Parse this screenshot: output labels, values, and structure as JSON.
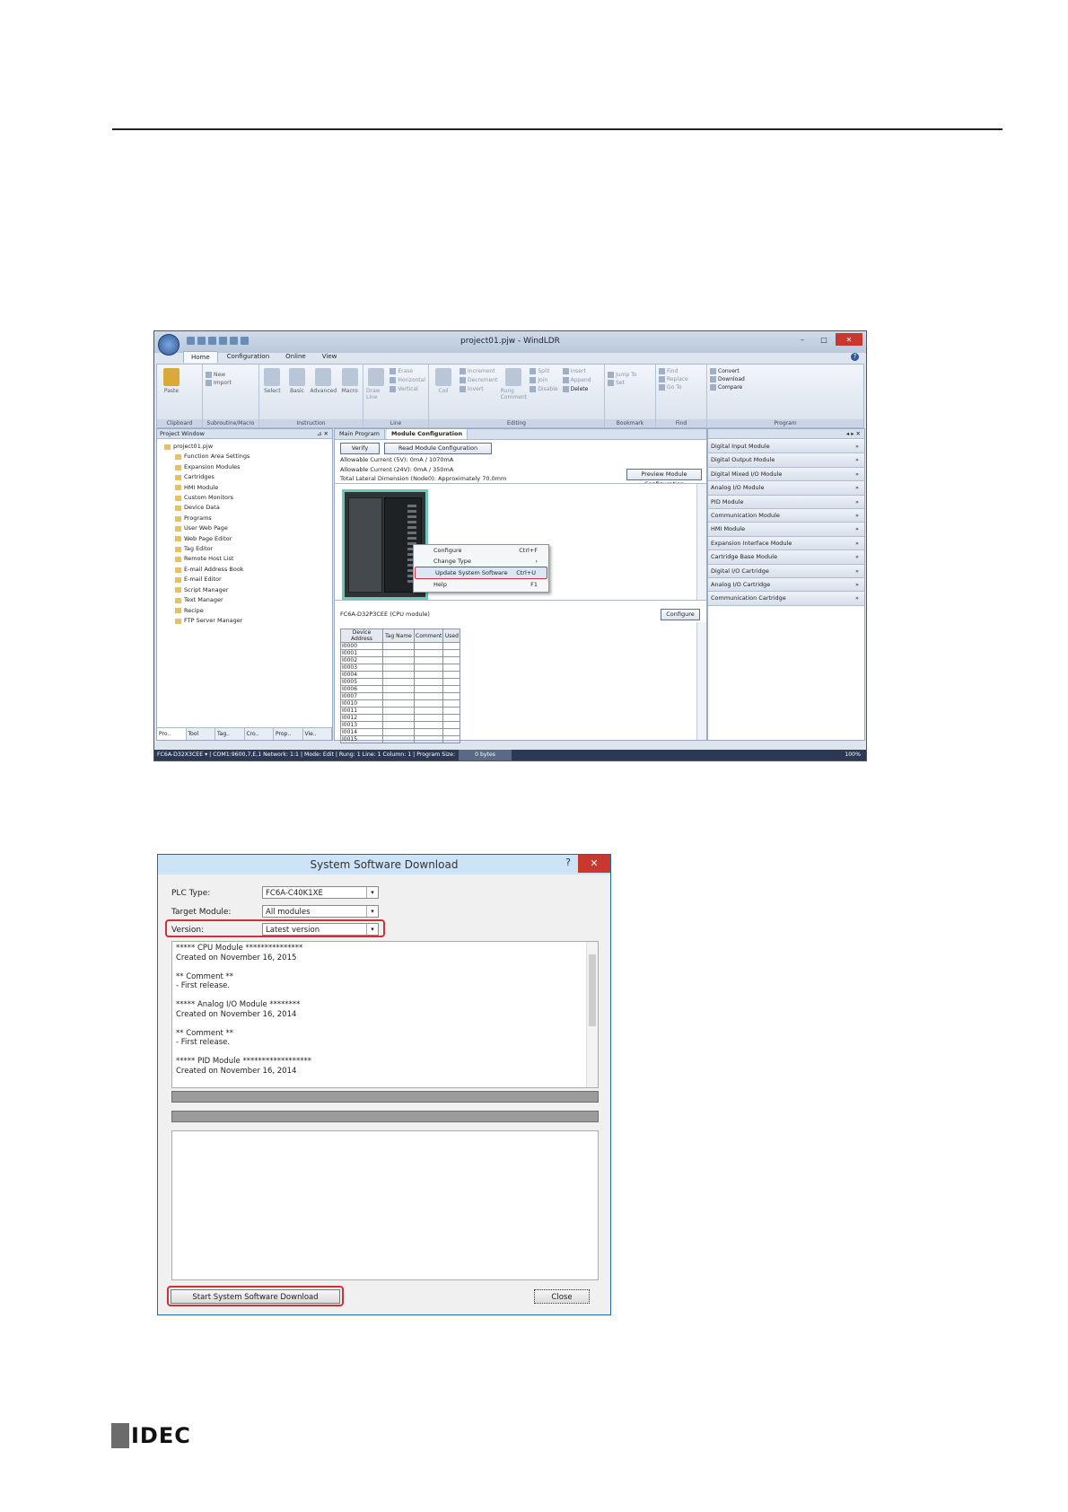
{
  "windldr": {
    "title": "project01.pjw - WindLDR",
    "window_controls": [
      "–",
      "□",
      "✕"
    ],
    "ribbon_tabs": [
      "Home",
      "Configuration",
      "Online",
      "View"
    ],
    "ribbon_groups": [
      {
        "name": "Clipboard",
        "items": [
          "Paste"
        ]
      },
      {
        "name": "Subroutine/Macro",
        "items": [
          "New",
          "Import"
        ]
      },
      {
        "name": "Instruction",
        "items": [
          "Select",
          "Basic",
          "Advanced",
          "Macro"
        ]
      },
      {
        "name": "Line",
        "items": [
          "Draw Line",
          "Erase",
          "Horizontal",
          "Vertical"
        ]
      },
      {
        "name": "Editing",
        "items": [
          "Coil",
          "Increment",
          "Decrement",
          "Invert",
          "Rung Comment",
          "Split",
          "Join",
          "Disable",
          "Insert",
          "Append",
          "Delete"
        ]
      },
      {
        "name": "Bookmark",
        "items": [
          "Jump To",
          "Set"
        ]
      },
      {
        "name": "Find",
        "items": [
          "Find",
          "Replace",
          "Go To"
        ]
      },
      {
        "name": "Program",
        "items": [
          "Convert",
          "Download",
          "Compare"
        ]
      }
    ],
    "project_window": {
      "title": "Project Window",
      "items": [
        {
          "label": "project01.pjw",
          "level": 0
        },
        {
          "label": "Function Area Settings",
          "level": 1
        },
        {
          "label": "Expansion Modules",
          "level": 1
        },
        {
          "label": "Cartridges",
          "level": 1
        },
        {
          "label": "HMI Module",
          "level": 1
        },
        {
          "label": "Custom Monitors",
          "level": 1
        },
        {
          "label": "Device Data",
          "level": 1
        },
        {
          "label": "Programs",
          "level": 1
        },
        {
          "label": "User Web Page",
          "level": 1
        },
        {
          "label": "Web Page Editor",
          "level": 1
        },
        {
          "label": "Tag Editor",
          "level": 1
        },
        {
          "label": "Remote Host List",
          "level": 1
        },
        {
          "label": "E-mail Address Book",
          "level": 1
        },
        {
          "label": "E-mail Editor",
          "level": 1
        },
        {
          "label": "Script Manager",
          "level": 1
        },
        {
          "label": "Text Manager",
          "level": 1
        },
        {
          "label": "Recipe",
          "level": 1
        },
        {
          "label": "FTP Server Manager",
          "level": 1
        }
      ],
      "bottom_tabs": [
        "Pro..",
        "Tool",
        "Tag..",
        "Cro..",
        "Prop..",
        "Vie.."
      ]
    },
    "doc_tabs": [
      "Main Program",
      "Module Configuration"
    ],
    "buttons": {
      "verify": "Verify",
      "read_config": "Read Module Configuration",
      "preview_config": "Preview Module Configuration",
      "configure": "Configure"
    },
    "info_lines": [
      "Allowable Current (5V): 0mA / 1070mA",
      "Allowable Current (24V): 0mA / 350mA",
      "Total Lateral Dimension (Node0): Approximately 70.0mm"
    ],
    "context_menu": [
      {
        "label": "Configure",
        "shortcut": "Ctrl+F"
      },
      {
        "label": "Change Type",
        "shortcut": "›"
      },
      {
        "label": "Update System Software",
        "shortcut": "Ctrl+U"
      },
      {
        "label": "Help",
        "shortcut": "F1"
      }
    ],
    "cpu_module": "FC6A-D32P3CEE (CPU module)",
    "device_table": {
      "headers": [
        "Device Address",
        "Tag Name",
        "Comment",
        "Used"
      ],
      "rows": [
        "I0000",
        "I0001",
        "I0002",
        "I0003",
        "I0004",
        "I0005",
        "I0006",
        "I0007",
        "I0010",
        "I0011",
        "I0012",
        "I0013",
        "I0014",
        "I0015"
      ]
    },
    "module_list": [
      "Digital Input Module",
      "Digital Output Module",
      "Digital Mixed I/O Module",
      "Analog I/O Module",
      "PID Module",
      "Communication Module",
      "HMI Module",
      "Expansion Interface Module",
      "Cartridge Base Module",
      "Digital I/O Cartridge",
      "Analog I/O Cartridge",
      "Communication Cartridge"
    ],
    "statusbar": {
      "text": "FC6A-D32X3CEE ▾ | COM1:9600,7,E,1  Network: 1:1 | Mode: Edit | Rung: 1  Line: 1  Column: 1 | Program Size:",
      "size": "0 bytes",
      "zoom": "100%"
    }
  },
  "dialog": {
    "title": "System Software Download",
    "help_glyph": "?",
    "close_glyph": "✕",
    "plc_type_label": "PLC Type:",
    "plc_type_value": "FC6A-C40K1XE",
    "target_label": "Target Module:",
    "target_value": "All modules",
    "version_label": "Version:",
    "version_value": "Latest version",
    "notes": [
      "***** CPU Module ***************",
      "Created on November 16, 2015",
      "",
      "** Comment **",
      "- First release.",
      "",
      "***** Analog I/O Module ********",
      "Created on November 16, 2014",
      "",
      "** Comment **",
      "- First release.",
      "",
      "***** PID Module ******************",
      "Created on November 16, 2014"
    ],
    "start_button": "Start System Software Download",
    "close_button": "Close"
  },
  "footer": {
    "logo_text": "IDEC"
  }
}
